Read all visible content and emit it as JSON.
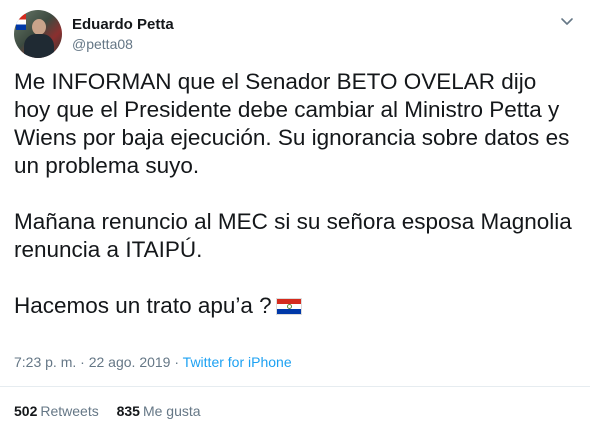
{
  "author": {
    "name": "Eduardo Petta",
    "handle": "@petta08"
  },
  "tweet": {
    "paragraphs": [
      "Me INFORMAN que el Senador BETO OVELAR dijo hoy que el Presidente debe cambiar al Ministro Petta y Wiens por baja ejecución. Su ignorancia sobre datos es un problema suyo.",
      "Mañana renuncio al MEC si su señora esposa Magnolia renuncia a ITAIPÚ.",
      "Hacemos un trato apu’a ?"
    ],
    "emoji": "flag-paraguay"
  },
  "meta": {
    "time": "7:23 p. m.",
    "separator1": " · ",
    "date": "22 ago. 2019",
    "separator2": " · ",
    "source": "Twitter for iPhone"
  },
  "stats": {
    "retweets_count": "502",
    "retweets_label": "Retweets",
    "likes_count": "835",
    "likes_label": "Me gusta"
  },
  "colors": {
    "text": "#14171a",
    "secondary": "#657786",
    "link": "#1da1f2",
    "divider": "#e6ecf0"
  }
}
